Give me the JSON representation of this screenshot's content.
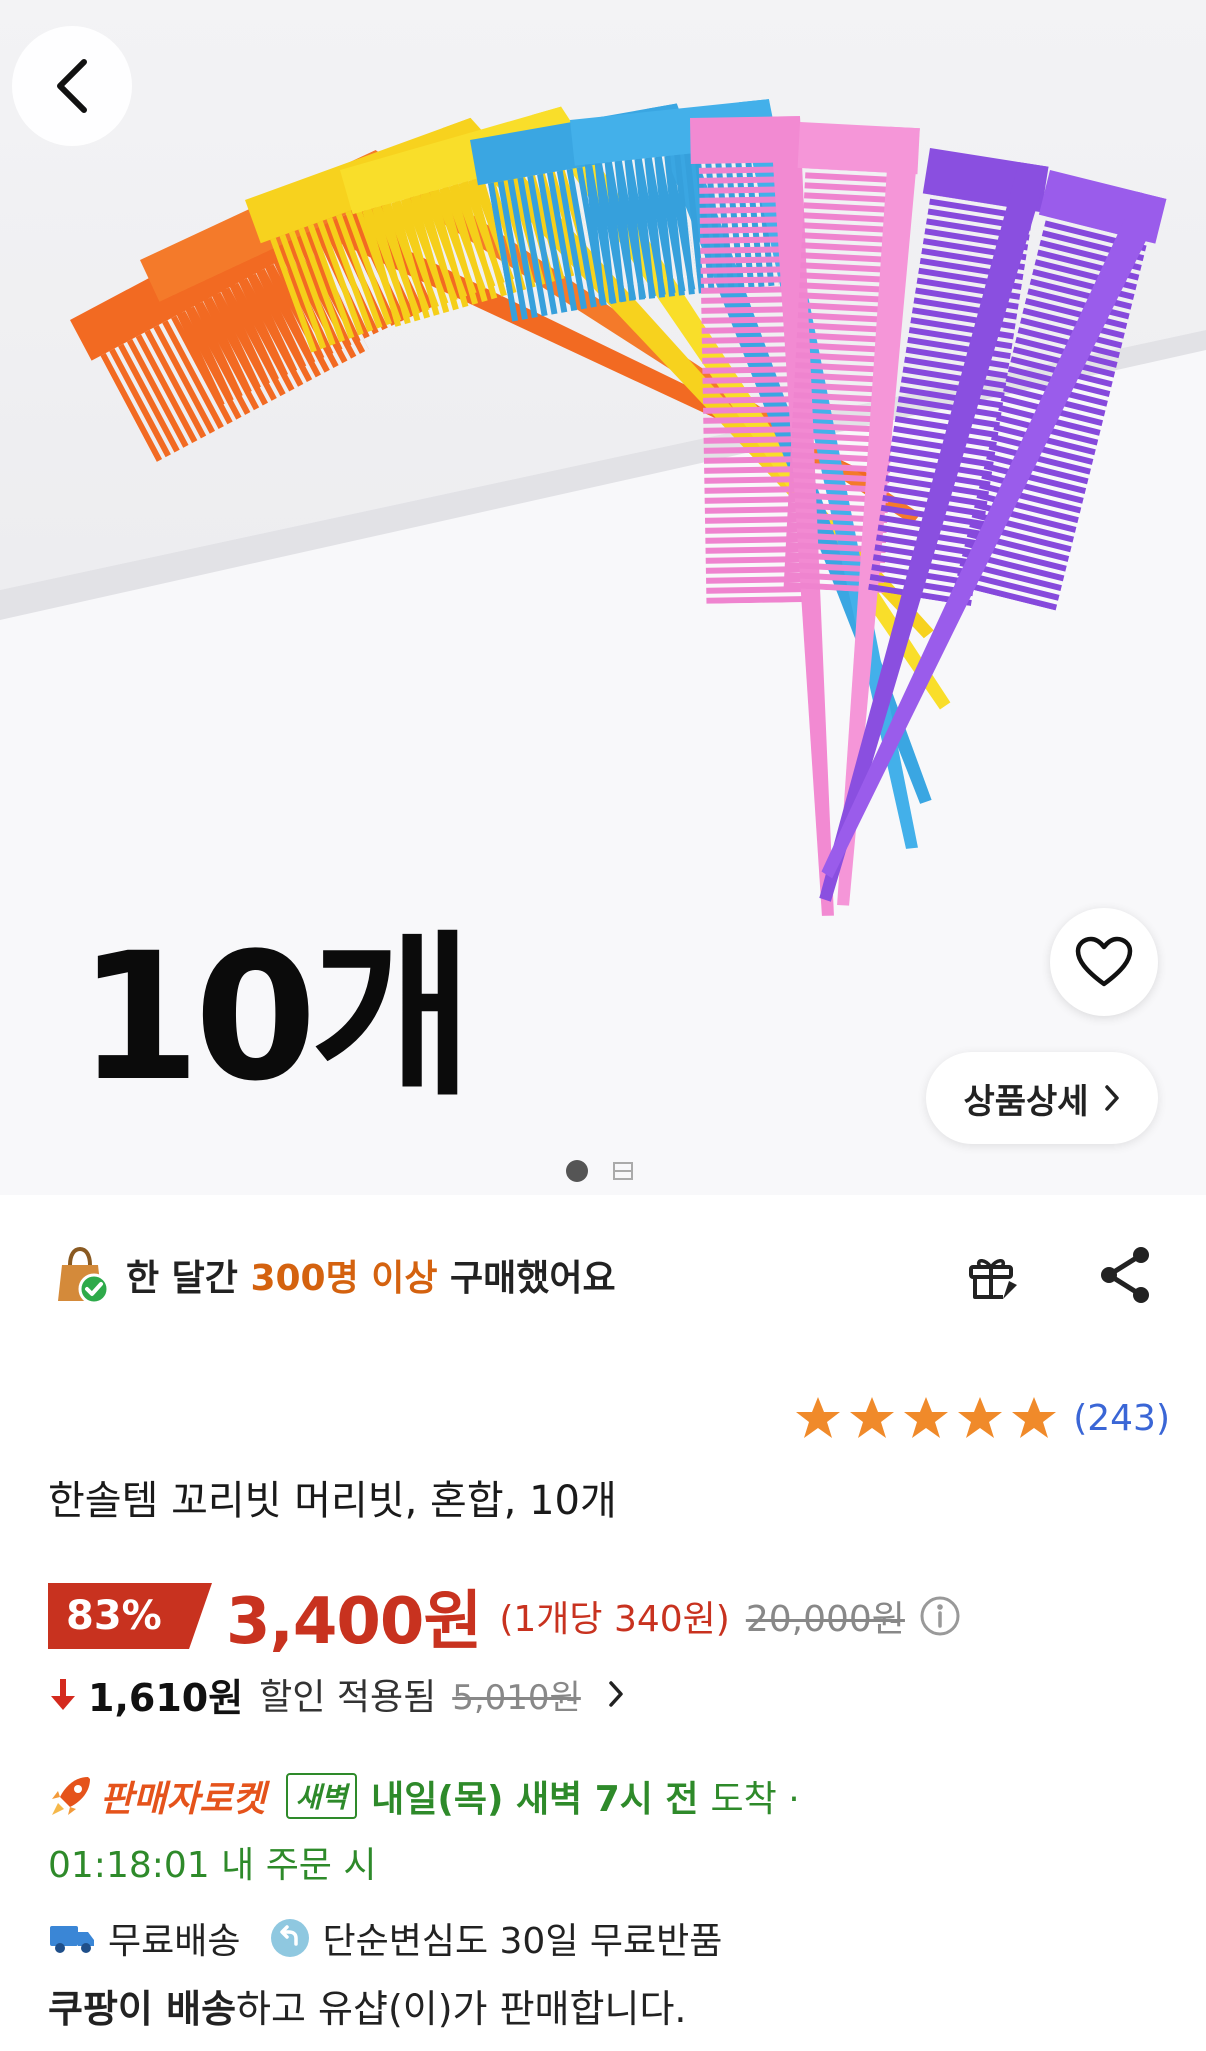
{
  "hero": {
    "qty_overlay": "10개",
    "detail_button": "상품상세",
    "image_count": 2,
    "current_image": 1
  },
  "purchase_notice": {
    "prefix": "한 달간 ",
    "highlight": "300명 이상",
    "suffix": " 구매했어요"
  },
  "rating": {
    "stars": 5,
    "count": "(243)"
  },
  "product": {
    "title": "한솔템 꼬리빗 머리빗, 혼합, 10개"
  },
  "price": {
    "discount_rate": "83%",
    "sale_price": "3,400원",
    "unit_price": "(1개당 340원)",
    "original_price": "20,000원"
  },
  "coupon": {
    "amount": "1,610원",
    "label": "할인 적용됨",
    "original": "5,010원"
  },
  "delivery": {
    "rocket_label": "판매자로켓",
    "dawn_badge": "새벽",
    "arrival_strong": "내일(목) 새벽 7시 전",
    "arrival_rest": "도착 ·",
    "timer": "01:18:01 내 주문 시"
  },
  "benefits": {
    "free_shipping": "무료배송",
    "free_return": "단순변심도 30일 무료반품"
  },
  "seller": {
    "bold": "쿠팡이 배송",
    "rest": "하고 유샵(이)가 판매합니다."
  },
  "colors": {
    "accent_red": "#c8321f",
    "highlight_orange": "#d4620f",
    "delivery_green": "#2e8a2a",
    "star": "#f08a2a",
    "link_blue": "#3a66d6"
  }
}
